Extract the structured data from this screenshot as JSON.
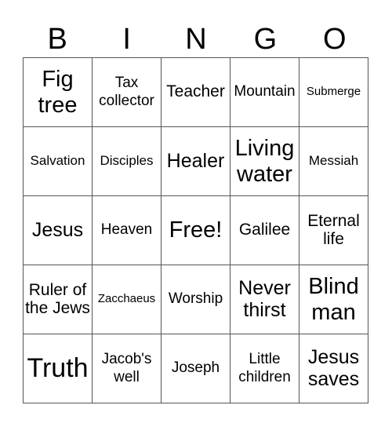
{
  "header": {
    "letters": [
      "B",
      "I",
      "N",
      "G",
      "O"
    ]
  },
  "grid": {
    "rows": [
      [
        "Fig tree",
        "Tax collector",
        "Teacher",
        "Mountain",
        "Submerge"
      ],
      [
        "Salvation",
        "Disciples",
        "Healer",
        "Living water",
        "Messiah"
      ],
      [
        "Jesus",
        "Heaven",
        "Free!",
        "Galilee",
        "Eternal life"
      ],
      [
        "Ruler of the Jews",
        "Zacchaeus",
        "Worship",
        "Never thirst",
        "Blind man"
      ],
      [
        "Truth",
        "Jacob's well",
        "Joseph",
        "Little children",
        "Jesus saves"
      ]
    ]
  }
}
